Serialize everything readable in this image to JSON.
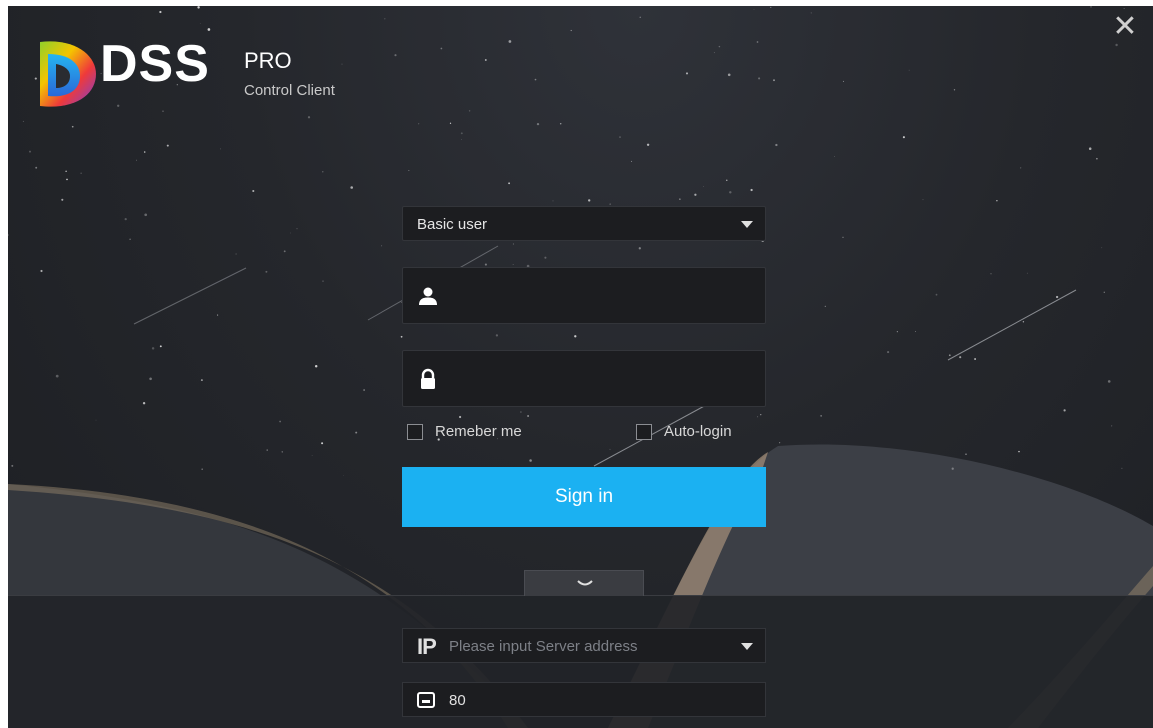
{
  "window": {
    "close_label": "✕"
  },
  "logo": {
    "name": "DSS",
    "pro": "PRO",
    "subtitle": "Control Client"
  },
  "login": {
    "user_type": "Basic user",
    "username_value": "",
    "password_value": "",
    "remember_label": "Remeber me",
    "remember_checked": false,
    "autologin_label": "Auto-login",
    "autologin_checked": false,
    "sign_in_label": "Sign in"
  },
  "server": {
    "ip_label": "IP",
    "placeholder": "Please input Server address",
    "port_value": "80"
  },
  "colors": {
    "accent": "#1bb1f2",
    "background": "#25272c"
  },
  "icons": {
    "user": "user-icon",
    "lock": "lock-icon",
    "dropdown": "caret-down-icon",
    "expand": "chevron-down-icon",
    "port": "port-icon",
    "close": "close-icon"
  }
}
